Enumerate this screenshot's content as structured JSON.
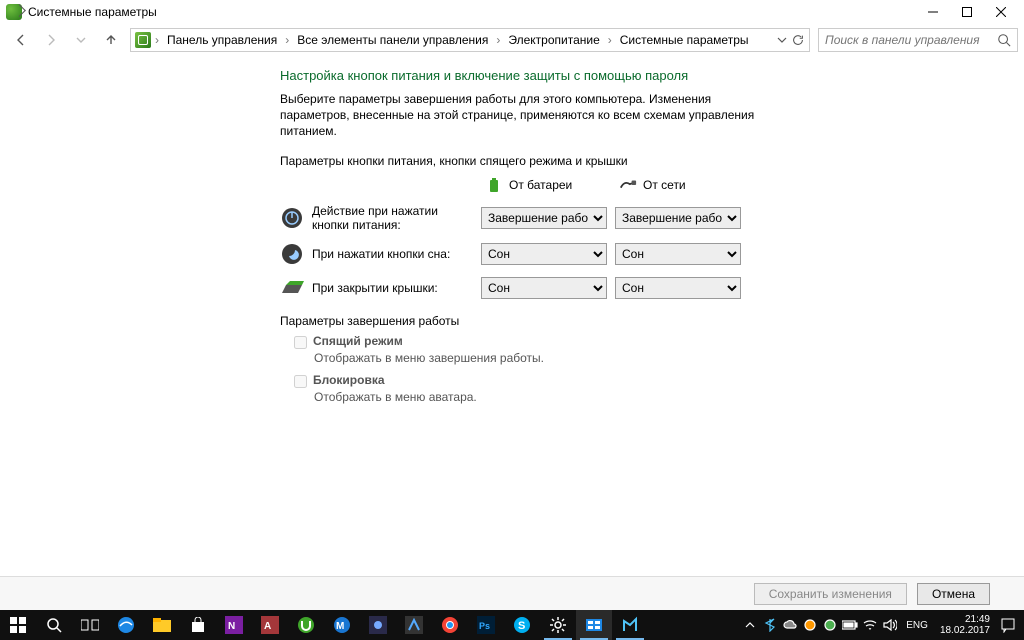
{
  "window": {
    "title": "Системные параметры"
  },
  "nav": {
    "breadcrumbs": [
      "Панель управления",
      "Все элементы панели управления",
      "Электропитание",
      "Системные параметры"
    ],
    "search_placeholder": "Поиск в панели управления"
  },
  "main": {
    "heading": "Настройка кнопок питания и включение защиты с помощью пароля",
    "description": "Выберите параметры завершения работы для этого компьютера. Изменения параметров, внесенные на этой странице, применяются ко всем схемам управления питанием.",
    "section1_label": "Параметры кнопки питания, кнопки спящего режима и крышки",
    "col_battery": "От батареи",
    "col_plugged": "От сети",
    "rows": [
      {
        "label": "Действие при нажатии кнопки питания:",
        "battery": "Завершение работы",
        "plugged": "Завершение работы"
      },
      {
        "label": "При нажатии кнопки сна:",
        "battery": "Сон",
        "plugged": "Сон"
      },
      {
        "label": "При закрытии крышки:",
        "battery": "Сон",
        "plugged": "Сон"
      }
    ],
    "section2_label": "Параметры завершения работы",
    "shutdown": [
      {
        "label": "Спящий режим",
        "sub": "Отображать в меню завершения работы."
      },
      {
        "label": "Блокировка",
        "sub": "Отображать в меню аватара."
      }
    ]
  },
  "footer": {
    "save": "Сохранить изменения",
    "cancel": "Отмена"
  },
  "taskbar": {
    "lang": "ENG",
    "time": "21:49",
    "date": "18.02.2017"
  }
}
